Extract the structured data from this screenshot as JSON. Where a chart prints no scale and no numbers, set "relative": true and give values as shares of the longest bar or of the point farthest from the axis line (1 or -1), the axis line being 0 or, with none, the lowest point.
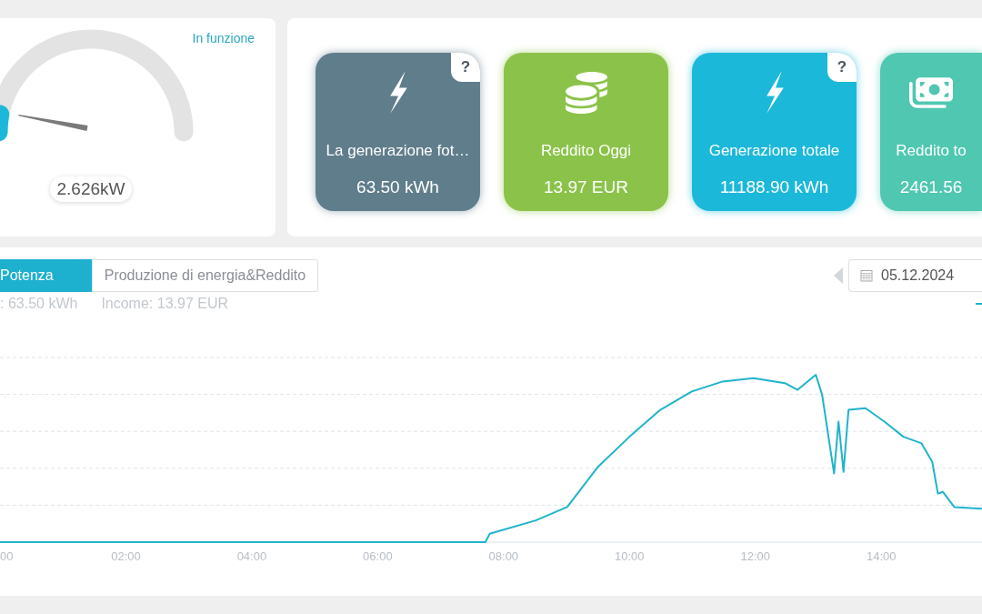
{
  "status_card": {
    "status": "In funzione",
    "gauge": {
      "level": 0.06,
      "reading": "2.626kW"
    }
  },
  "tiles": [
    {
      "kind": "energy",
      "label": "La generazione fot…",
      "value": "63.50 kWh",
      "color": "#607d8b",
      "help": "?"
    },
    {
      "kind": "income",
      "label": "Reddito Oggi",
      "value": "13.97 EUR",
      "color": "#8bc34a"
    },
    {
      "kind": "energy",
      "label": "Generazione totale",
      "value": "11188.90 kWh",
      "color": "#1cb8d9",
      "help": "?"
    },
    {
      "kind": "earnings",
      "label": "Reddito to",
      "value": "2461.56",
      "color": "#4fc7b1"
    }
  ],
  "chart_panel": {
    "tabs": [
      {
        "label": "Potenza",
        "selected": true
      },
      {
        "label": "Produzione di energia&Reddito",
        "selected": false
      }
    ],
    "summary": [
      ": 63.50 kWh",
      "Income: 13.97 EUR"
    ],
    "date_picker": {
      "value": "05.12.2024"
    },
    "chart_data": {
      "type": "line",
      "relative": true,
      "x": [
        0,
        7.71,
        7.78,
        8.51,
        9.01,
        9.5,
        10.0,
        10.49,
        10.99,
        11.48,
        11.97,
        12.47,
        12.67,
        12.96,
        13.06,
        13.25,
        13.32,
        13.4,
        13.48,
        13.75,
        14.05,
        14.35,
        14.64,
        14.81,
        14.9,
        14.98,
        15.16,
        15.6
      ],
      "values": [
        0,
        0,
        0.05,
        0.13,
        0.21,
        0.45,
        0.63,
        0.79,
        0.9,
        0.96,
        0.98,
        0.95,
        0.91,
        1.0,
        0.88,
        0.41,
        0.72,
        0.42,
        0.79,
        0.8,
        0.72,
        0.63,
        0.59,
        0.48,
        0.29,
        0.3,
        0.21,
        0.2
      ],
      "xlim": [
        0,
        15.6
      ],
      "xticks": [
        {
          "value": 0,
          "label": "00"
        },
        {
          "value": 2,
          "label": "02:00"
        },
        {
          "value": 4,
          "label": "04:00"
        },
        {
          "value": 6,
          "label": "06:00"
        },
        {
          "value": 8,
          "label": "08:00"
        },
        {
          "value": 10,
          "label": "10:00"
        },
        {
          "value": 12,
          "label": "12:00"
        },
        {
          "value": 14,
          "label": "14:00"
        }
      ]
    }
  }
}
